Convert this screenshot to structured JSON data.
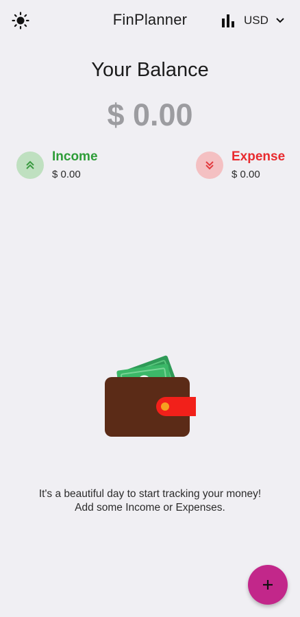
{
  "header": {
    "title": "FinPlanner",
    "currency": "USD",
    "theme_icon": "sun-icon",
    "stats_icon": "bar-chart-icon",
    "dropdown_icon": "chevron-down-icon"
  },
  "balance": {
    "title": "Your Balance",
    "amount": "$ 0.00"
  },
  "summary": {
    "income": {
      "label": "Income",
      "value": "$ 0.00",
      "icon": "double-chevron-up-icon",
      "color": "#2e9d38"
    },
    "expense": {
      "label": "Expense",
      "value": "$ 0.00",
      "icon": "double-chevron-down-icon",
      "color": "#e82b2f"
    }
  },
  "empty_state": {
    "illustration": "wallet-icon",
    "line1": "It's a beautiful day to start tracking your money!",
    "line2": "Add some Income or Expenses."
  },
  "fab": {
    "label": "+",
    "icon": "plus-icon",
    "color": "#c2278a"
  }
}
